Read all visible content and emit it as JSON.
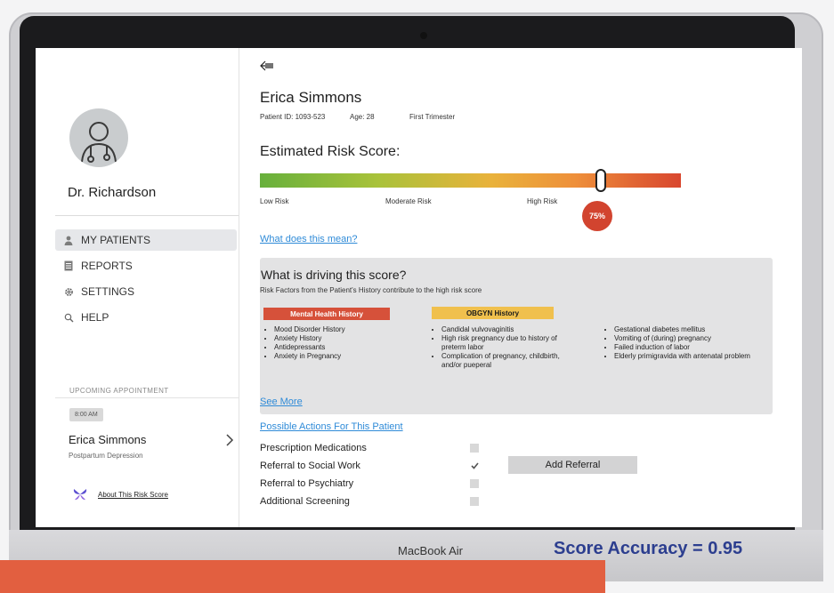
{
  "device": {
    "brand_label": "MacBook Air"
  },
  "overlay": {
    "score_accuracy": "Score Accuracy = 0.95",
    "caption": ""
  },
  "sidebar": {
    "doctor_name": "Dr. Richardson",
    "nav": [
      {
        "label": "MY PATIENTS",
        "icon": "person-icon",
        "active": true
      },
      {
        "label": "REPORTS",
        "icon": "document-icon",
        "active": false
      },
      {
        "label": "SETTINGS",
        "icon": "gear-icon",
        "active": false
      },
      {
        "label": "HELP",
        "icon": "search-icon",
        "active": false
      }
    ],
    "upcoming_label": "UPCOMING APPOINTMENT",
    "appointment": {
      "time": "8:00 AM",
      "name": "Erica Simmons",
      "condition": "Postpartum Depression"
    },
    "about_link": "About This Risk Score"
  },
  "patient": {
    "name": "Erica Simmons",
    "id_label": "Patient ID: 1093-523",
    "age_label": "Age: 28",
    "stage": "First Trimester"
  },
  "risk": {
    "title": "Estimated Risk Score:",
    "score_percent": 75,
    "badge": "75%",
    "labels": {
      "low": "Low Risk",
      "moderate": "Moderate Risk",
      "high": "High Risk"
    },
    "meaning_link": "What does this mean?",
    "colors": {
      "low": "#67b03c",
      "mid": "#e9b23b",
      "high": "#d9472f"
    }
  },
  "drivers": {
    "title": "What is driving this score?",
    "subtitle": "Risk Factors from the Patient's History contribute to the high risk score",
    "mental_health_tag": "Mental Health History",
    "obgyn_tag": "OBGYN History",
    "mental_health": [
      "Mood Disorder History",
      "Anxiety History",
      "Antidepressants",
      "Anxiety in Pregnancy"
    ],
    "obgyn_col1": [
      "Candidal vulvovaginitis",
      "High risk pregnancy due to history of preterm labor",
      "Complication of pregnancy, childbirth, and/or pueperal"
    ],
    "obgyn_col2": [
      "Gestational diabetes mellitus",
      "Vomiting of (during) pregnancy",
      "Failed induction of labor",
      "Elderly primigravida with antenatal problem"
    ],
    "see_more": "See More"
  },
  "actions": {
    "title": "Possible Actions For This Patient",
    "items": [
      {
        "label": "Prescription Medications",
        "checked": false
      },
      {
        "label": "Referral to Social Work",
        "checked": true
      },
      {
        "label": "Referral to Psychiatry",
        "checked": false
      },
      {
        "label": "Additional Screening",
        "checked": false
      }
    ],
    "add_referral": "Add Referral"
  }
}
